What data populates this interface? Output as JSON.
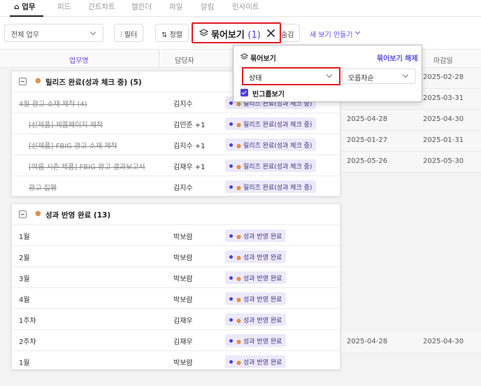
{
  "tabs": [
    {
      "label": "업무",
      "icon": "home-icon",
      "active": true
    },
    {
      "label": "피드"
    },
    {
      "label": "간트차트"
    },
    {
      "label": "캘린더"
    },
    {
      "label": "파일"
    },
    {
      "label": "알림"
    },
    {
      "label": "인사이트"
    }
  ],
  "toolbar": {
    "scope_select": "전체 업무",
    "filter": "필터",
    "sort": "정렬",
    "group_label": "묶어보기",
    "group_count": "(1)",
    "hide_partial": "숨김",
    "new_view": "새 보기 만들기"
  },
  "columns": {
    "name": "업무명",
    "owner": "담당자",
    "due": "마감일"
  },
  "groups": [
    {
      "title": "릴리즈 완료(성과 체크 중) (5)",
      "status_label": "릴리즈 완료(성과 체크 중)",
      "rows": [
        {
          "name": "4월 광고 소재 제작 (4)",
          "owner": "김지수"
        },
        {
          "name": "[신제품] 제품페이지 제작",
          "owner": "김민준 +1"
        },
        {
          "name": "[신제품] FBIG 광고 소재 제작",
          "owner": "김지수 +1"
        },
        {
          "name": "[여름 시즌 제품] FBIG 광고 결과보고서",
          "owner": "김재우 +1"
        },
        {
          "name": "광고 집행",
          "owner": "김지수"
        }
      ]
    },
    {
      "title": "성과 반영 완료 (13)",
      "status_label": "성과 반영 완료",
      "rows": [
        {
          "name": "1월",
          "owner": "박보람"
        },
        {
          "name": "2월",
          "owner": "박보람"
        },
        {
          "name": "3월",
          "owner": "박보람"
        },
        {
          "name": "4월",
          "owner": "박보람"
        },
        {
          "name": "1주차",
          "owner": "김재우"
        },
        {
          "name": "2주차",
          "owner": "김재우"
        },
        {
          "name": "1월",
          "owner": "박보람"
        }
      ]
    }
  ],
  "background_dates": [
    {
      "single": "2025-02-28"
    },
    {
      "single": "2025-03-31"
    },
    {
      "start": "2025-04-28",
      "due": "2025-04-30"
    },
    {
      "start": "2025-01-27",
      "due": "2025-01-31"
    },
    {
      "start": "2025-05-26",
      "due": "2025-05-30"
    },
    {
      "start": "2025-04-28",
      "due": "2025-04-30"
    }
  ],
  "popover": {
    "title": "묶어보기",
    "unset": "묶어보기 해제",
    "field_select": "상태",
    "order_select": "오름차순",
    "show_empty_label": "빈그룹보기",
    "show_empty_checked": true
  },
  "colors": {
    "accent": "#5b4ee8",
    "highlight": "#e01b22",
    "pill_bg": "#ece9fb"
  }
}
